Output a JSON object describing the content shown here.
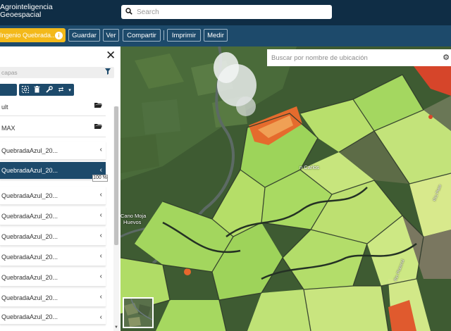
{
  "header": {
    "brand_line1": "Agrointeligencia",
    "brand_line2": "Geoespacial",
    "search_placeholder": "Search"
  },
  "toolbar": {
    "scene_label": "Ingenio Quebrada...",
    "buttons": [
      "Guardar",
      "Ver",
      "Compartir",
      "Imprimir",
      "Medir"
    ]
  },
  "panel": {
    "filter_placeholder": "capas",
    "opacity_label": "100 %",
    "rows": [
      {
        "label": "ult",
        "action": "folder-icon"
      },
      {
        "label": "MAX",
        "action": "folder-icon"
      },
      {
        "label": "QuebradaAzul_20...",
        "action": "chevron-left-icon"
      },
      {
        "label": "QuebradaAzul_20...",
        "action": "chevron-left-icon"
      },
      {
        "label": "QuebradaAzul_20...",
        "action": "chevron-left-icon"
      },
      {
        "label": "QuebradaAzul_20...",
        "action": "chevron-left-icon"
      },
      {
        "label": "QuebradaAzul_20...",
        "action": "chevron-left-icon"
      },
      {
        "label": "QuebradaAzul_20...",
        "action": "chevron-left-icon"
      },
      {
        "label": "QuebradaAzul_20...",
        "action": "chevron-left-icon"
      },
      {
        "label": "QuebradaAzul_20...",
        "action": "chevron-left-icon"
      },
      {
        "label": "QuebradaAzul_20...",
        "action": "chevron-left-icon"
      }
    ]
  },
  "map": {
    "location_search_placeholder": "Buscar por nombre de ubicación",
    "place_1": "n Carlos",
    "place_2": "Cano Moja",
    "place_3": "Huevos",
    "road_1": "Río Plate",
    "road_2": "Rio Platanal"
  },
  "colors": {
    "header_bg": "#0f2d45",
    "toolbar_bg": "#1d4a6b",
    "accent": "#f3b91a"
  }
}
